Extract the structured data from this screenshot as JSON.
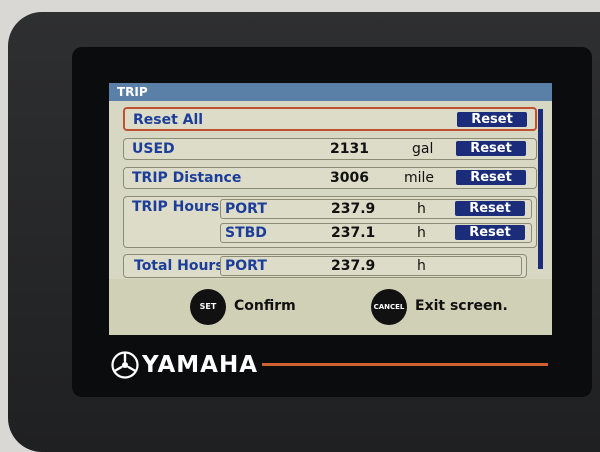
{
  "screen": {
    "title": "TRIP",
    "reset_all": {
      "label": "Reset All",
      "button": "Reset"
    },
    "rows": {
      "used": {
        "label": "USED",
        "value": "2131",
        "unit": "gal",
        "button": "Reset"
      },
      "trip_distance": {
        "label": "TRIP Distance",
        "value": "3006",
        "unit": "mile",
        "button": "Reset"
      },
      "trip_hours": {
        "label": "TRIP Hours",
        "port": {
          "label": "PORT",
          "value": "237.9",
          "unit": "h",
          "button": "Reset"
        },
        "stbd": {
          "label": "STBD",
          "value": "237.1",
          "unit": "h",
          "button": "Reset"
        }
      },
      "total_hours": {
        "label": "Total Hours",
        "port": {
          "label": "PORT",
          "value": "237.9",
          "unit": "h"
        }
      }
    },
    "footer": {
      "set_key": "SET",
      "set_text": "Confirm",
      "cancel_key": "CANCEL",
      "cancel_text": "Exit screen."
    }
  },
  "device": {
    "brand": "YAMAHA"
  },
  "colors": {
    "accent": "#1b2d7a",
    "title_bar": "#5b80a8",
    "selection": "#c0502f",
    "brand_line": "#d06030"
  }
}
